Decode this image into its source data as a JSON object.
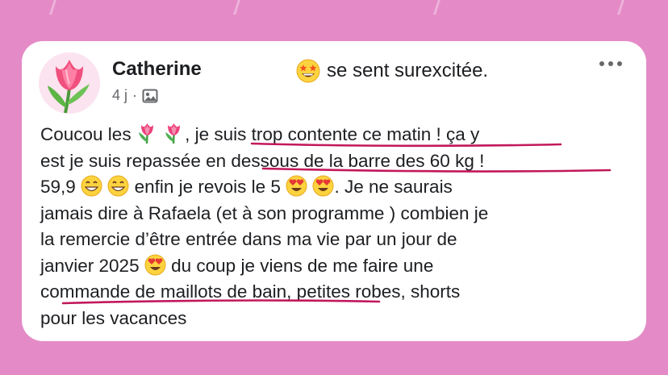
{
  "post": {
    "author": "Catherine",
    "feeling": "se sent surexcitée.",
    "feeling_icon": "star-struck-emoji-icon",
    "time": "4 j",
    "separator": "·",
    "audience_icon": "photo-icon",
    "more_icon": "more-options-icon",
    "avatar_icon": "tulip-avatar-icon"
  },
  "body_lines": {
    "l1a": "Coucou les",
    "l1b": ", ",
    "l1c": "je suis trop contente ce matin",
    "l1d": " ! ça y",
    "l2a": "est je suis repassée ",
    "l2b": "en dessous de la barre des 60 kg",
    "l2c": " !",
    "l3a": "59,9",
    "l3b": "enfin je revois le 5",
    "l3c": ". Je ne saurais",
    "l4": "jamais dire à Rafaela (et à son programme ) combien je",
    "l5": "la remercie d’être entrée dans ma vie par un jour de",
    "l6a": "janvier 2025",
    "l6b": "du coup je viens de me faire une",
    "l7a": "commande de maillots de bain",
    "l7b": ", petites robes,  shorts",
    "l8": "pour les vacances"
  },
  "colors": {
    "background": "#e48bc7",
    "card": "#ffffff",
    "underline": "#c2185b",
    "text": "#1c1e21",
    "meta": "#65676b"
  }
}
